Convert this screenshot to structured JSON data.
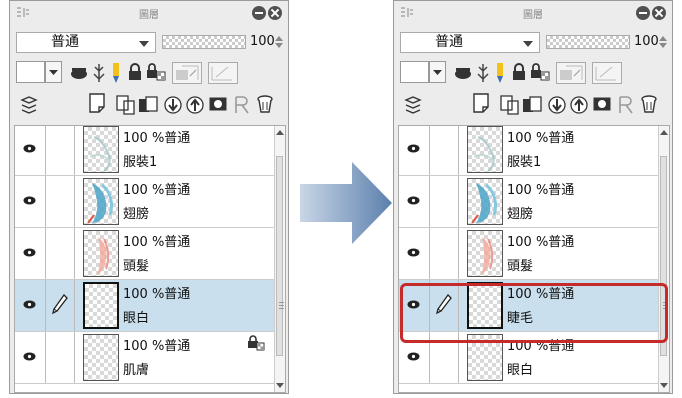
{
  "panel_title": "圖層",
  "blend_mode": "普通",
  "opacity_value": "100",
  "icons": {
    "grip": "panel-grip-icon",
    "minimize": "minimize-icon",
    "close": "close-icon",
    "layer_stack": "layer-stack-icon",
    "new_raster": "new-raster-layer-icon",
    "new_vector": "new-vector-layer-icon",
    "new_folder": "new-folder-icon",
    "transfer_down": "transfer-to-lower-icon",
    "merge": "merge-layer-icon",
    "mask": "layer-mask-icon",
    "apply_mask": "apply-mask-icon",
    "delete": "delete-layer-icon",
    "visible": "eye-icon",
    "editing": "pencil-icon",
    "lock": "lock-icon"
  },
  "colors": {
    "highlight": "#d42a2a",
    "selected_row": "#c9dfee",
    "arrow": "#6d8fb8"
  },
  "left_panel": {
    "layers": [
      {
        "info": "100 %普通",
        "name": "服裝1",
        "art": "clothes",
        "selected": false,
        "editing": false,
        "locked": false
      },
      {
        "info": "100 %普通",
        "name": "翅膀",
        "art": "wings",
        "selected": false,
        "editing": false,
        "locked": false
      },
      {
        "info": "100 %普通",
        "name": "頭髮",
        "art": "hair",
        "selected": false,
        "editing": false,
        "locked": false
      },
      {
        "info": "100 %普通",
        "name": "眼白",
        "art": "blank",
        "selected": true,
        "editing": true,
        "locked": false
      },
      {
        "info": "100 %普通",
        "name": "肌膚",
        "art": "blank",
        "selected": false,
        "editing": false,
        "locked": true
      }
    ]
  },
  "right_panel": {
    "layers": [
      {
        "info": "100 %普通",
        "name": "服裝1",
        "art": "clothes",
        "selected": false,
        "editing": false,
        "locked": false
      },
      {
        "info": "100 %普通",
        "name": "翅膀",
        "art": "wings",
        "selected": false,
        "editing": false,
        "locked": false
      },
      {
        "info": "100 %普通",
        "name": "頭髮",
        "art": "hair",
        "selected": false,
        "editing": false,
        "locked": false
      },
      {
        "info": "100 %普通",
        "name": "睫毛",
        "art": "blank",
        "selected": true,
        "editing": true,
        "locked": false
      },
      {
        "info": "100 %普通",
        "name": "眼白",
        "art": "blank",
        "selected": false,
        "editing": false,
        "locked": false
      }
    ]
  }
}
